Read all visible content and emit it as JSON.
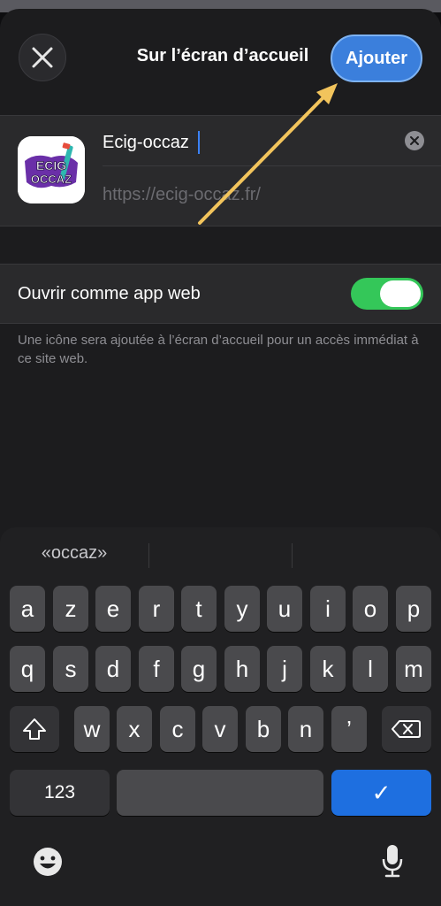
{
  "header": {
    "title": "Sur l’écran d’accueil",
    "add_label": "Ajouter"
  },
  "app_card": {
    "name_value": "Ecig-occaz",
    "url": "https://ecig-occaz.fr/",
    "icon_text_1": "ECIG",
    "icon_text_2": "OCCAZ"
  },
  "settings": {
    "web_app_label": "Ouvrir comme app web",
    "web_app_enabled": true,
    "footnote": "Une icône sera ajoutée à l’écran d’accueil pour un accès immédiat à ce site web."
  },
  "keyboard": {
    "suggestions": [
      "«occaz»",
      "",
      ""
    ],
    "row1": [
      "a",
      "z",
      "e",
      "r",
      "t",
      "y",
      "u",
      "i",
      "o",
      "p"
    ],
    "row2": [
      "q",
      "s",
      "d",
      "f",
      "g",
      "h",
      "j",
      "k",
      "l",
      "m"
    ],
    "row3": [
      "w",
      "x",
      "c",
      "v",
      "b",
      "n",
      "’"
    ],
    "numbers_label": "123",
    "done_symbol": "✓"
  },
  "colors": {
    "accent": "#3b7fdc",
    "toggle_on": "#34c759",
    "arrow": "#f2c45c"
  }
}
